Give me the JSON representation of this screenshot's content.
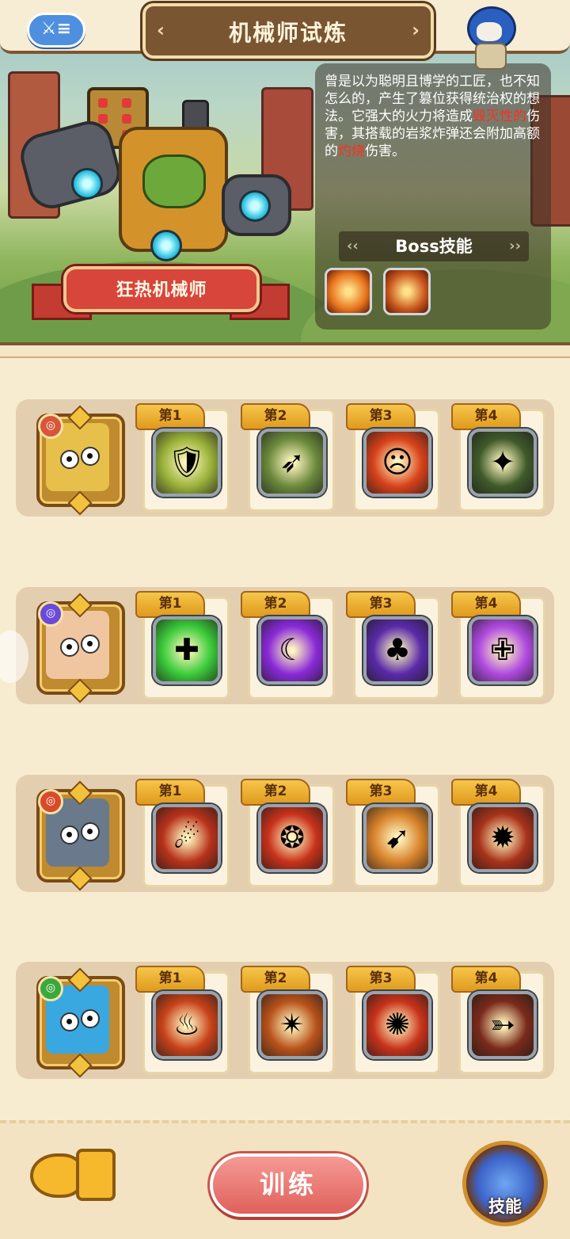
{
  "header": {
    "title": "机械师试炼",
    "back_icon": "sword-list-icon"
  },
  "boss": {
    "name": "狂热机械师",
    "description_parts": [
      {
        "text": "曾是以为聪明且博学的工匠，也不知怎么的，产生了篡位获得统治权的想法。它强大的火力将造成",
        "red": false
      },
      {
        "text": "毁灭性的",
        "red": true
      },
      {
        "text": "伤害，其搭载的岩浆炸弹还会附加高额的",
        "red": false
      },
      {
        "text": "灼烧",
        "red": true
      },
      {
        "text": "伤害。",
        "red": false
      }
    ],
    "skills_header": "Boss技能",
    "skills": [
      {
        "icon": "fire-slash-icon",
        "color": "#e8721c"
      },
      {
        "icon": "fire-swirl-icon",
        "color": "#c9551c"
      }
    ]
  },
  "rows": [
    {
      "hero": "pig-warrior",
      "badge_color": "#d8553a",
      "portrait_color": "#e6c04a",
      "skills": [
        {
          "label": "第1",
          "icon": "golden-shield-icon",
          "glyph": "🛡",
          "bg": "#9bb33a"
        },
        {
          "label": "第2",
          "icon": "spiked-arrow-icon",
          "glyph": "➶",
          "bg": "#6c8a3c"
        },
        {
          "label": "第3",
          "icon": "angry-face-icon",
          "glyph": "☹",
          "bg": "#d8421a"
        },
        {
          "label": "第4",
          "icon": "dark-claw-icon",
          "glyph": "✦",
          "bg": "#3f5a2a"
        }
      ]
    },
    {
      "hero": "horse-king",
      "badge_color": "#6a4ad8",
      "portrait_color": "#f0c6a0",
      "skills": [
        {
          "label": "第1",
          "icon": "green-heal-icon",
          "glyph": "✚",
          "bg": "#3ccc3a"
        },
        {
          "label": "第2",
          "icon": "purple-wave-icon",
          "glyph": "☾",
          "bg": "#8a2ad8"
        },
        {
          "label": "第3",
          "icon": "purple-sprout-icon",
          "glyph": "♣",
          "bg": "#5a2aa8"
        },
        {
          "label": "第4",
          "icon": "winged-shield-icon",
          "glyph": "✙",
          "bg": "#b04ae0"
        }
      ]
    },
    {
      "hero": "hippo-beast",
      "badge_color": "#d84a2a",
      "portrait_color": "#6a7a8c",
      "skills": [
        {
          "label": "第1",
          "icon": "fire-beast-icon",
          "glyph": "☄",
          "bg": "#b8321a"
        },
        {
          "label": "第2",
          "icon": "paw-print-icon",
          "glyph": "❂",
          "bg": "#c8321a"
        },
        {
          "label": "第3",
          "icon": "fire-claw-icon",
          "glyph": "➹",
          "bg": "#d8822a"
        },
        {
          "label": "第4",
          "icon": "fire-bomb-icon",
          "glyph": "✹",
          "bg": "#a8321a"
        }
      ]
    },
    {
      "hero": "fish-warrior",
      "badge_color": "#3aa83a",
      "portrait_color": "#3aa8e0",
      "skills": [
        {
          "label": "第1",
          "icon": "campfire-icon",
          "glyph": "♨",
          "bg": "#c8421a"
        },
        {
          "label": "第2",
          "icon": "feather-spikes-icon",
          "glyph": "✴",
          "bg": "#b8521a"
        },
        {
          "label": "第3",
          "icon": "spiked-mace-icon",
          "glyph": "✺",
          "bg": "#c8321a"
        },
        {
          "label": "第4",
          "icon": "crossbow-icon",
          "glyph": "➳",
          "bg": "#7a2a1a"
        }
      ]
    }
  ],
  "bottom": {
    "train_label": "训练",
    "skill_label": "技能",
    "fish_icon": "fish-bone-icon"
  }
}
